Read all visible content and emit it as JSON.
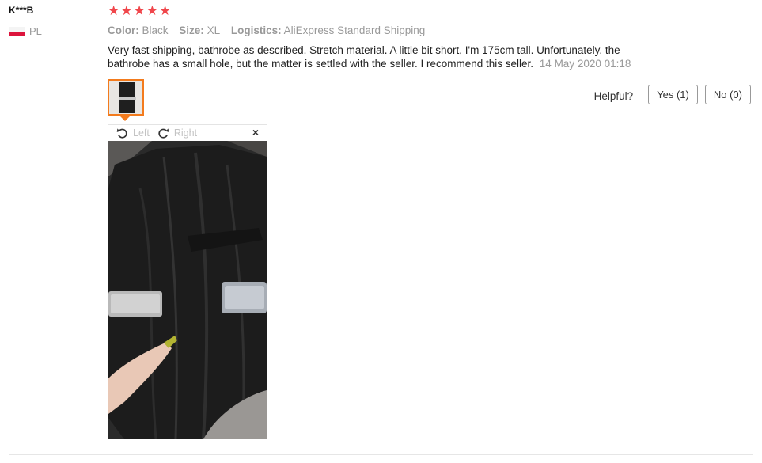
{
  "review": {
    "username": "K***B",
    "country": "PL",
    "rating": 5,
    "stars": [
      "★",
      "★",
      "★",
      "★",
      "★"
    ],
    "meta": {
      "color_label": "Color:",
      "color_value": "Black",
      "size_label": "Size:",
      "size_value": "XL",
      "logistics_label": "Logistics:",
      "logistics_value": "AliExpress Standard Shipping"
    },
    "text": "Very fast shipping, bathrobe as described. Stretch material. A little bit short, I'm 175cm tall. Unfortunately, the bathrobe has a small hole, but the matter is settled with the seller. I recommend this seller.",
    "date": "14 May 2020 01:18"
  },
  "helpful": {
    "label": "Helpful?",
    "yes": "Yes (1)",
    "no": "No (0)"
  },
  "viewer": {
    "rotate_left": "Left",
    "rotate_right": "Right",
    "close": "×"
  },
  "colors": {
    "star": "#f0464b",
    "accent": "#f37b1d"
  }
}
